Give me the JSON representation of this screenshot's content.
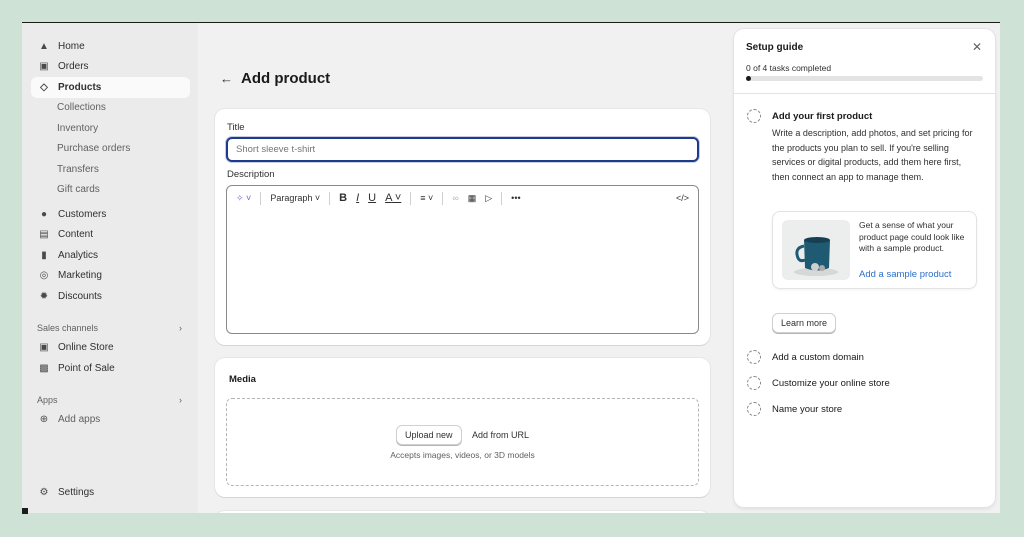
{
  "sidebar": {
    "main_items": [
      {
        "label": "Home",
        "icon": "home-icon"
      },
      {
        "label": "Orders",
        "icon": "inbox-icon"
      },
      {
        "label": "Products",
        "icon": "tag-icon",
        "active": true
      }
    ],
    "product_subitems": [
      "Collections",
      "Inventory",
      "Purchase orders",
      "Transfers",
      "Gift cards"
    ],
    "more_items": [
      {
        "label": "Customers",
        "icon": "person-icon"
      },
      {
        "label": "Content",
        "icon": "content-icon"
      },
      {
        "label": "Analytics",
        "icon": "bar-chart-icon"
      },
      {
        "label": "Marketing",
        "icon": "target-icon"
      },
      {
        "label": "Discounts",
        "icon": "discount-icon"
      }
    ],
    "sales_channels_label": "Sales channels",
    "channels": [
      {
        "label": "Online Store",
        "icon": "store-icon"
      },
      {
        "label": "Point of Sale",
        "icon": "pos-icon"
      }
    ],
    "apps_label": "Apps",
    "add_apps_label": "Add apps",
    "settings_label": "Settings"
  },
  "page": {
    "title": "Add product"
  },
  "product_card": {
    "title_label": "Title",
    "title_placeholder": "Short sleeve t-shirt",
    "description_label": "Description",
    "toolbar": {
      "paragraph_label": "Paragraph",
      "bold": "B",
      "italic": "I",
      "underline": "U",
      "text_color": "A",
      "more": "•••",
      "code": "</>"
    }
  },
  "media_card": {
    "title": "Media",
    "upload_label": "Upload new",
    "add_url_label": "Add from URL",
    "hint": "Accepts images, videos, or 3D models"
  },
  "setup_guide": {
    "title": "Setup guide",
    "close": "✕",
    "progress_text": "0 of 4 tasks completed",
    "progress_fraction": 0.02,
    "tasks": [
      {
        "title": "Add your first product"
      },
      {
        "title": "Add a custom domain"
      },
      {
        "title": "Customize your online store"
      },
      {
        "title": "Name your store"
      }
    ],
    "first_task_description": "Write a description, add photos, and set pricing for the products you plan to sell. If you're selling services or digital products, add them here first, then connect an app to manage them.",
    "sample_text": "Get a sense of what your product page could look like with a sample product.",
    "sample_link": "Add a sample product",
    "learn_more": "Learn more"
  }
}
